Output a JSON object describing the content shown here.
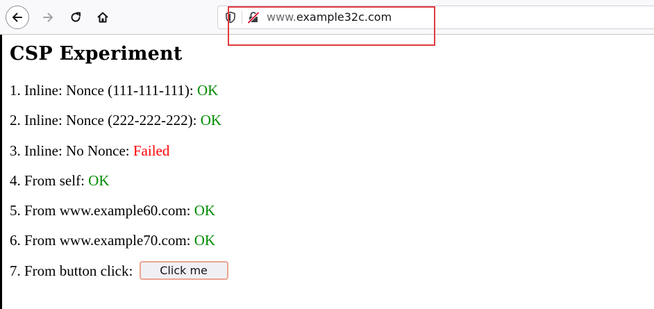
{
  "browser": {
    "url_prefix": "www.",
    "url_host": "example32c.com"
  },
  "page": {
    "title": "CSP Experiment",
    "items": [
      {
        "label": "1. Inline: Nonce (111-111-111): ",
        "status": "OK"
      },
      {
        "label": "2. Inline: Nonce (222-222-222): ",
        "status": "OK"
      },
      {
        "label": "3. Inline: No Nonce: ",
        "status": "Failed"
      },
      {
        "label": "4. From self: ",
        "status": "OK"
      },
      {
        "label": "5. From www.example60.com: ",
        "status": "OK"
      },
      {
        "label": "6. From www.example70.com: ",
        "status": "OK"
      },
      {
        "label": "7. From button click: "
      }
    ],
    "button_label": "Click me"
  },
  "colors": {
    "ok": "#008a00",
    "failed": "#ff0000",
    "annotation_box": "#e0393e"
  },
  "icons": {
    "back": "arrow-left-icon",
    "forward": "arrow-right-icon",
    "reload": "reload-icon",
    "home": "home-icon",
    "tracking_protection": "shield-icon",
    "connection": "insecure-lock-icon"
  }
}
